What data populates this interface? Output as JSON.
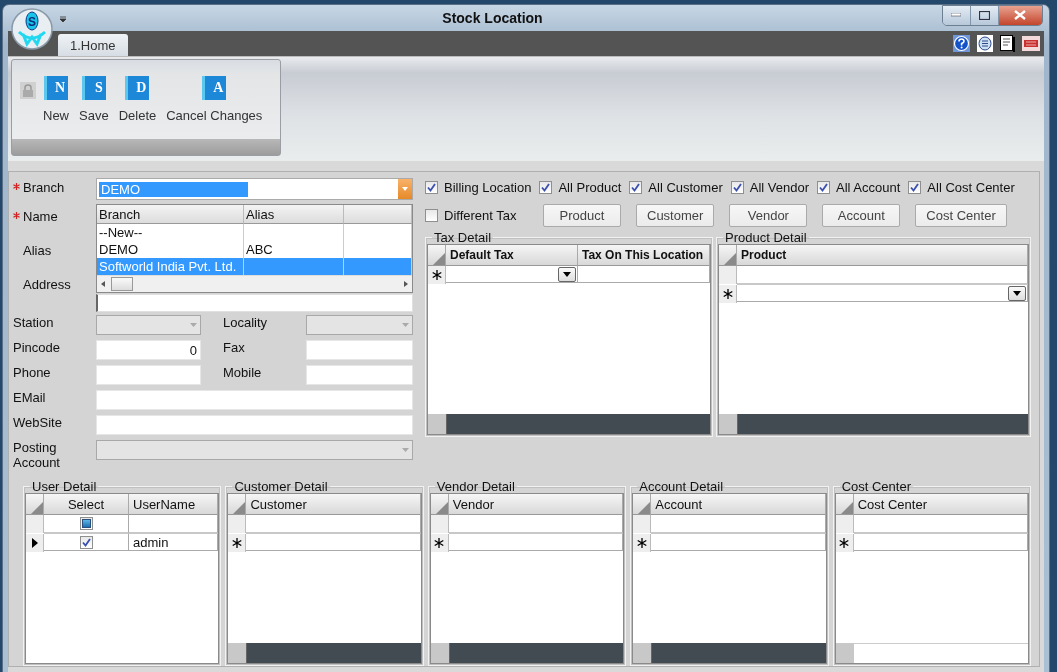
{
  "window": {
    "title": "Stock Location",
    "logo_letter": "S"
  },
  "tabs": [
    {
      "label": "1.Home",
      "selected": true
    }
  ],
  "ribbon": {
    "buttons": [
      {
        "label": "New",
        "icon_letter": "N"
      },
      {
        "label": "Save",
        "icon_letter": "S"
      },
      {
        "label": "Delete",
        "icon_letter": "D"
      },
      {
        "label": "Cancel Changes",
        "icon_letter": "A"
      }
    ]
  },
  "branch": {
    "label": "Branch",
    "required": true,
    "value": "DEMO"
  },
  "lookup": {
    "columns": [
      "Branch",
      "Alias"
    ],
    "rows": [
      {
        "branch": "--New--",
        "selected": false
      },
      {
        "branch": "DEMO",
        "alias": "ABC",
        "selected": false
      },
      {
        "branch": "Softworld India Pvt. Ltd.",
        "selected": true
      }
    ]
  },
  "name_labels": [
    {
      "label": "Name",
      "required": true
    },
    {
      "label": "Alias",
      "required": false
    },
    {
      "label": "Address",
      "required": false
    }
  ],
  "field_rows": [
    [
      {
        "label": "Station",
        "kind": "combo",
        "disabled": true
      },
      {
        "label": "Locality",
        "kind": "combo",
        "disabled": true
      }
    ],
    [
      {
        "label": "Pincode",
        "kind": "number",
        "value": "0"
      },
      {
        "label": "Fax",
        "kind": "text"
      }
    ],
    [
      {
        "label": "Phone",
        "kind": "text"
      },
      {
        "label": "Mobile",
        "kind": "text"
      }
    ],
    [
      {
        "label": "EMail",
        "kind": "text"
      }
    ],
    [
      {
        "label": "WebSite",
        "kind": "text"
      }
    ],
    [
      {
        "label": "Posting Account",
        "kind": "combo",
        "disabled": true
      }
    ]
  ],
  "checkboxes": [
    {
      "label": "Billing Location",
      "checked": true
    },
    {
      "label": "All Product",
      "checked": true
    },
    {
      "label": "All Customer",
      "checked": true
    },
    {
      "label": "All Vendor",
      "checked": true
    },
    {
      "label": "All Account",
      "checked": true
    },
    {
      "label": "All Cost Center",
      "checked": true
    }
  ],
  "different_tax": {
    "label": "Different Tax",
    "checked": false
  },
  "buttons": [
    "Product",
    "Customer",
    "Vendor",
    "Account",
    "Cost Center"
  ],
  "tax_detail": {
    "title": "Tax Detail",
    "bold_headers": true,
    "filter_row": false,
    "footer_dark": true,
    "columns": [
      {
        "label": "Default Tax",
        "kind": "dropdown"
      },
      {
        "label": "Tax On This Location",
        "kind": "text"
      }
    ],
    "rows": [
      {
        "kind": "new"
      }
    ]
  },
  "product_detail": {
    "title": "Product Detail",
    "bold_headers": true,
    "filter_row": true,
    "footer_dark": true,
    "columns": [
      {
        "label": "Product",
        "kind": "dropdown"
      }
    ],
    "rows": [
      {
        "kind": "new"
      }
    ]
  },
  "bottom_grids": [
    {
      "title": "User Detail",
      "bold_headers": false,
      "filter_row": true,
      "columns": [
        {
          "label": "Select",
          "kind": "checkbox",
          "filter_indeterminate": true
        },
        {
          "label": "UserName",
          "kind": "text"
        }
      ],
      "rows": [
        {
          "kind": "current",
          "cells": [
            {
              "checked": true
            },
            {
              "text": "admin"
            }
          ]
        }
      ]
    },
    {
      "title": "Customer Detail",
      "bold_headers": false,
      "filter_row": true,
      "footer_dark": true,
      "columns": [
        {
          "label": "Customer",
          "kind": "text"
        }
      ],
      "rows": [
        {
          "kind": "new"
        }
      ]
    },
    {
      "title": "Vendor Detail",
      "bold_headers": false,
      "filter_row": true,
      "footer_dark": true,
      "columns": [
        {
          "label": "Vendor",
          "kind": "text"
        }
      ],
      "rows": [
        {
          "kind": "new"
        }
      ]
    },
    {
      "title": "Account Detail",
      "bold_headers": false,
      "filter_row": true,
      "footer_dark": true,
      "columns": [
        {
          "label": "Account",
          "kind": "text"
        }
      ],
      "rows": [
        {
          "kind": "new"
        }
      ]
    },
    {
      "title": "Cost Center",
      "bold_headers": false,
      "filter_row": true,
      "footer_dark": false,
      "columns": [
        {
          "label": "Cost Center",
          "kind": "text"
        }
      ],
      "rows": [
        {
          "kind": "new"
        }
      ]
    }
  ]
}
